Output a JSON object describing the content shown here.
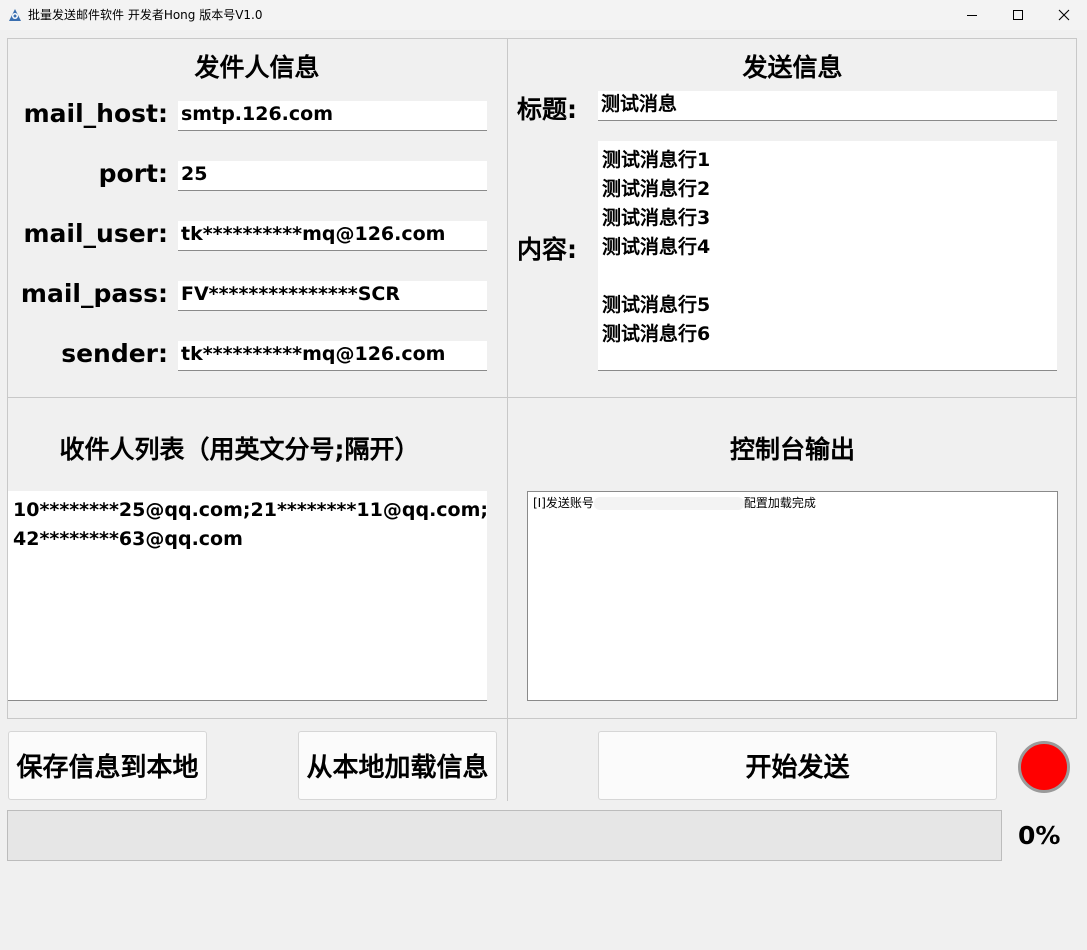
{
  "window": {
    "title": "批量发送邮件软件 开发者Hong 版本号V1.0"
  },
  "sender_section": {
    "title": "发件人信息",
    "fields": [
      {
        "label": "mail_host:",
        "value": "smtp.126.com"
      },
      {
        "label": "port:",
        "value": "25"
      },
      {
        "label": "mail_user:",
        "value": "tk**********mq@126.com"
      },
      {
        "label": "mail_pass:",
        "value": "FV***************SCR"
      },
      {
        "label": "sender:",
        "value": "tk**********mq@126.com"
      }
    ]
  },
  "send_section": {
    "title": "发送信息",
    "subject_label": "标题:",
    "subject_value": "测试消息",
    "content_label": "内容:",
    "content_value": "测试消息行1\n测试消息行2\n测试消息行3\n测试消息行4\n\n测试消息行5\n测试消息行6"
  },
  "recipients_section": {
    "title": "收件人列表（用英文分号;隔开）",
    "value": "10********25@qq.com;21********11@qq.com;\n42********63@qq.com"
  },
  "console_section": {
    "title": "控制台输出",
    "log_prefix": "[I]发送账号",
    "log_suffix": "配置加载完成"
  },
  "buttons": {
    "save": "保存信息到本地",
    "load": "从本地加载信息",
    "start": "开始发送"
  },
  "status": {
    "indicator_color": "#ff0000",
    "progress_percent": 0,
    "progress_label": "0%"
  }
}
